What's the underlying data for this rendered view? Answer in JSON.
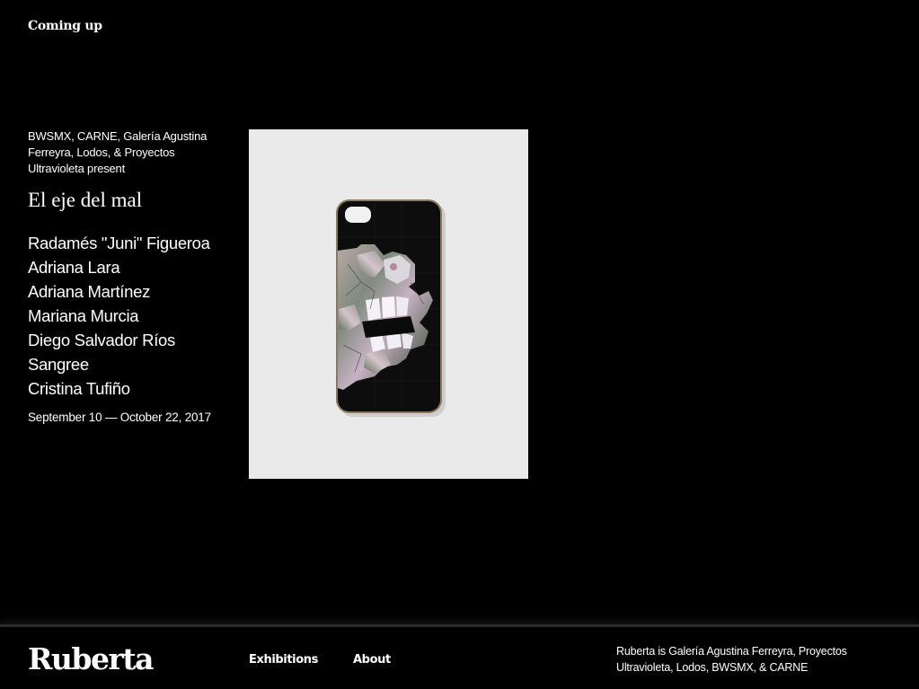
{
  "section": {
    "heading": "Coming up"
  },
  "exhibition": {
    "presenters": "BWSMX, CARNE, Galería Agustina Ferreyra, Lodos, & Proyectos Ultravioleta present",
    "title": "El eje del mal",
    "artists": [
      "Radamés \"Juni\" Figueroa",
      "Adriana Lara",
      "Adriana Martínez",
      "Mariana Murcia",
      "Diego Salvador Ríos",
      "Sangree",
      "Cristina Tufiño"
    ],
    "dates": "September 10 — October 22, 2017",
    "image_alt": "Mother-of-pearl mosaic phone case with skull design"
  },
  "footer": {
    "logo": "Ruberta",
    "nav": {
      "exhibitions": "Exhibitions",
      "about": "About"
    },
    "blurb": "Ruberta is Galería Agustina Ferreyra, Proyectos Ultravioleta, Lodos, BWSMX, & CARNE"
  }
}
